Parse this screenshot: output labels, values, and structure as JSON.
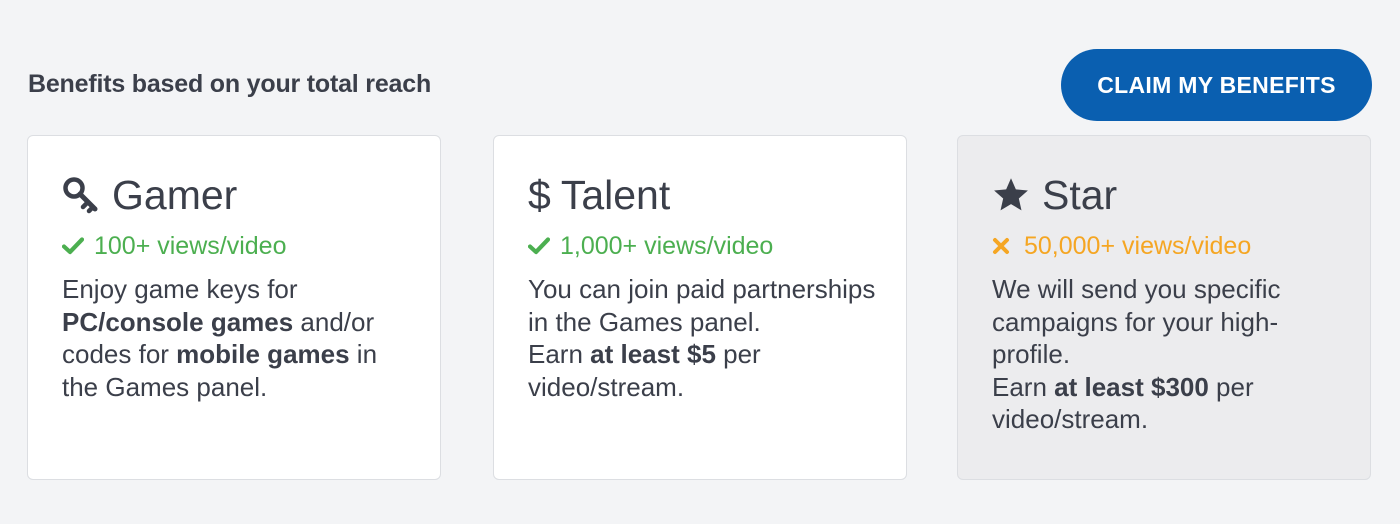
{
  "header": {
    "title": "Benefits based on your total reach",
    "claim_button": "CLAIM MY BENEFITS"
  },
  "colors": {
    "accent": "#0a5fb0",
    "met": "#4caf50",
    "unmet": "#f5a623",
    "text": "#3b3f4a"
  },
  "tiers": [
    {
      "name": "Gamer",
      "icon": "key-icon",
      "requirement": "100+ views/video",
      "requirement_met": true,
      "desc": {
        "p1": "Enjoy game keys for ",
        "b1": "PC/console games",
        "p2": " and/or codes for ",
        "b2": "mobile games",
        "p3": " in the Games panel."
      }
    },
    {
      "name": "Talent",
      "icon": "dollar-icon",
      "icon_glyph": "$",
      "requirement": "1,000+ views/video",
      "requirement_met": true,
      "desc": {
        "line1": "You can join paid partnerships in the Games panel.",
        "earn_prefix": "Earn ",
        "earn_bold": "at least $5",
        "earn_suffix": " per video/stream."
      }
    },
    {
      "name": "Star",
      "icon": "star-icon",
      "requirement": "50,000+ views/video",
      "requirement_met": false,
      "desc": {
        "line1": "We will send you specific campaigns for your high-profile.",
        "earn_prefix": "Earn ",
        "earn_bold": "at least $300",
        "earn_suffix": " per video/stream."
      }
    }
  ]
}
